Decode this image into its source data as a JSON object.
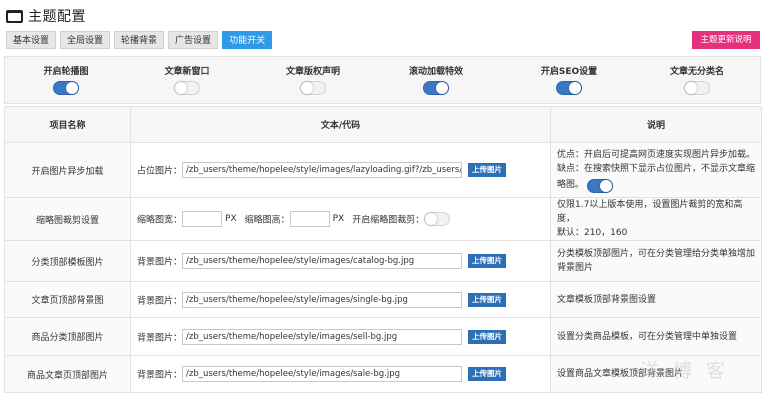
{
  "header": {
    "title": "主题配置"
  },
  "tabs": [
    {
      "label": "基本设置",
      "active": false
    },
    {
      "label": "全局设置",
      "active": false
    },
    {
      "label": "轮播背景",
      "active": false
    },
    {
      "label": "广告设置",
      "active": false
    },
    {
      "label": "功能开关",
      "active": true
    }
  ],
  "update_button": "主题更新说明",
  "switches": [
    {
      "label": "开启轮播图",
      "on": true
    },
    {
      "label": "文章新窗口",
      "on": false
    },
    {
      "label": "文章版权声明",
      "on": false
    },
    {
      "label": "滚动加载特效",
      "on": true
    },
    {
      "label": "开启SEO设置",
      "on": true
    },
    {
      "label": "文章无分类名",
      "on": false
    }
  ],
  "table": {
    "headers": {
      "name": "项目名称",
      "code": "文本/代码",
      "desc": "说明"
    },
    "upload_label": "上传图片",
    "rows": [
      {
        "name": "开启图片异步加载",
        "field_label": "占位图片：",
        "value": "/zb_users/theme/hopelee/style/images/lazyloading.gif?/zb_users/theme",
        "desc_lines": [
          "优点：开启后可提高网页速度实现图片异步加载。",
          "缺点：在搜索快照下显示占位图片，不显示文章缩略图。"
        ],
        "toggle_on": true
      },
      {
        "name": "缩略图裁剪设置",
        "width_label": "缩略图宽：",
        "height_label": "缩略图高：",
        "unit": "PX",
        "crop_label": "开启缩略图裁剪：",
        "crop_on": false,
        "desc_lines": [
          "仅限1.7以上版本使用，设置图片裁剪的宽和高度，",
          "默认：210，160"
        ]
      },
      {
        "name": "分类顶部模板图片",
        "field_label": "背景图片：",
        "value": "/zb_users/theme/hopelee/style/images/catalog-bg.jpg",
        "desc_lines": [
          "分类模板顶部图片，可在分类管理给分类单独增加",
          "背景图片"
        ]
      },
      {
        "name": "文章页顶部背景图",
        "field_label": "背景图片：",
        "value": "/zb_users/theme/hopelee/style/images/single-bg.jpg",
        "desc_lines": [
          "文章模板顶部背景图设置"
        ]
      },
      {
        "name": "商品分类顶部图片",
        "field_label": "背景图片：",
        "value": "/zb_users/theme/hopelee/style/images/sell-bg.jpg",
        "desc_lines": [
          "设置分类商品模板，可在分类管理中单独设置"
        ]
      },
      {
        "name": "商品文章页顶部图片",
        "field_label": "背景图片：",
        "value": "/zb_users/theme/hopelee/style/images/sale-bg.jpg",
        "desc_lines": [
          "设置商品文章模板顶部背景图片"
        ]
      }
    ]
  },
  "watermark": "洋 博 客",
  "colors": {
    "tab_active": "#2d9be8",
    "update_button": "#e5307e",
    "toggle_on": "#3a78c5",
    "upload_button": "#2c6fb5"
  }
}
